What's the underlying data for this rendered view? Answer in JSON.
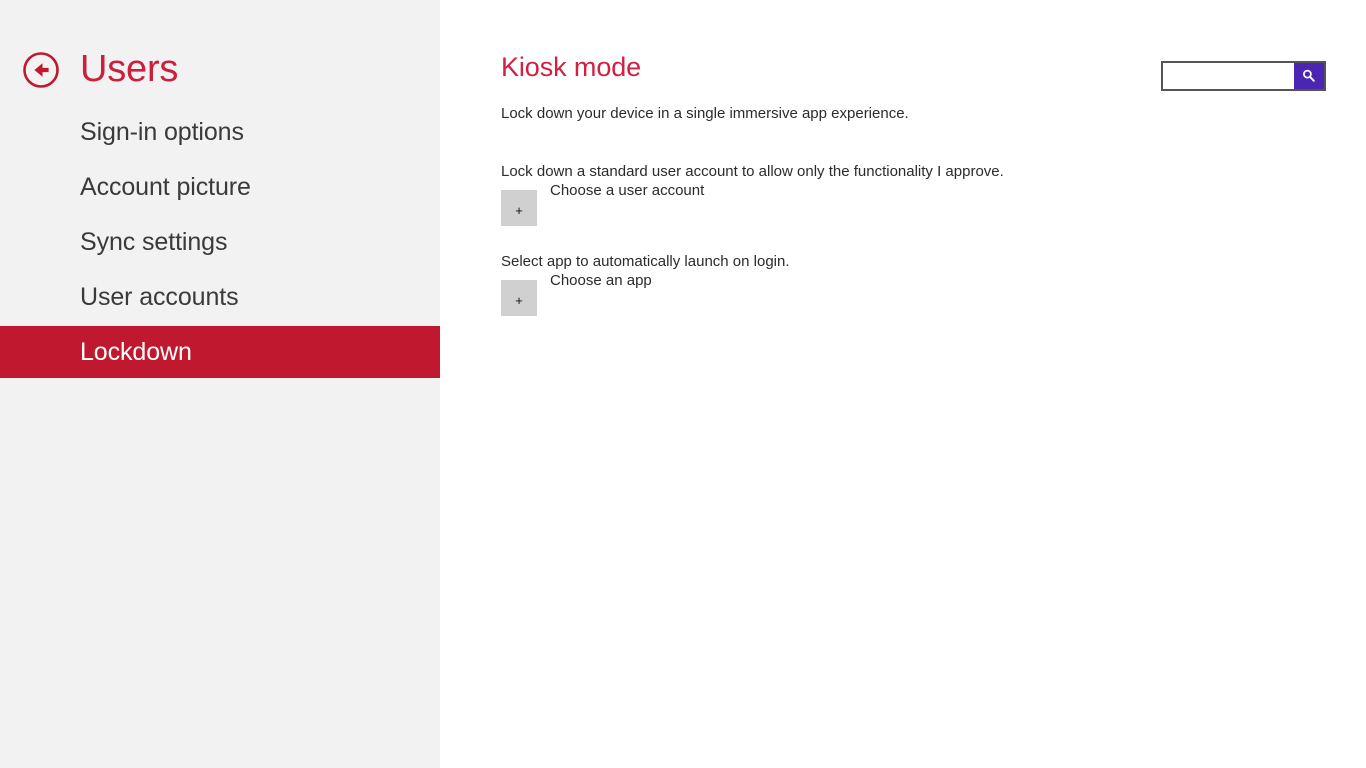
{
  "sidebar": {
    "back_button": {
      "icon": "back-arrow-circle-icon",
      "label": "Back"
    },
    "title": "Users",
    "items": [
      {
        "label": "Sign-in options",
        "selected": false
      },
      {
        "label": "Account picture",
        "selected": false
      },
      {
        "label": "Sync settings",
        "selected": false
      },
      {
        "label": "User accounts",
        "selected": false
      },
      {
        "label": "Lockdown",
        "selected": true
      }
    ],
    "colors": {
      "background": "#f2f2f2",
      "title": "#cc1f3c",
      "selected_background": "#c0182f",
      "selected_text": "#ffffff",
      "item_text": "#3a3a3a"
    }
  },
  "main": {
    "heading": "Kiosk mode",
    "subtitle": "Lock down your device in a single immersive app experience.",
    "sections": [
      {
        "label": "Lock down a standard user account to allow only the functionality I approve.",
        "button_icon": "plus-icon",
        "button_glyph": "+",
        "caption": "Choose a user account"
      },
      {
        "label": "Select app to automatically launch on login.",
        "button_icon": "plus-icon",
        "button_glyph": "+",
        "caption": "Choose an app"
      }
    ],
    "colors": {
      "heading": "#d31f43",
      "text": "#2b2b2b",
      "button_background": "#d0d0d0"
    }
  },
  "search": {
    "value": "",
    "placeholder": "",
    "submit_icon": "search-icon",
    "colors": {
      "border": "#555555",
      "button_background": "#4a26b2"
    }
  }
}
